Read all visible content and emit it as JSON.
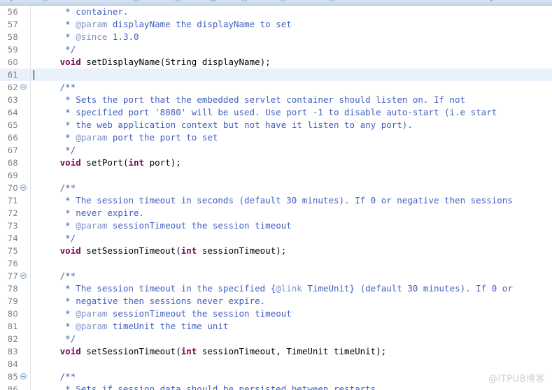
{
  "toolbar": {
    "glyphs": [
      "▾",
      "▭",
      "↶",
      "↷",
      "▭",
      "▭",
      "⌘",
      "▭",
      "▭",
      "▭",
      "▾"
    ]
  },
  "editor": {
    "first_visible_line": 56,
    "active_line": 61,
    "cursor_column": 1,
    "colors": {
      "javadoc": "#3f5fbf",
      "javadoc_tag": "#7a93c9",
      "keyword": "#7f0055",
      "plain": "#000000",
      "active_line_bg": "#e9f1fd",
      "line_number": "#7d7d7d",
      "background": "#ffffff"
    },
    "lines": [
      {
        "num": "56",
        "fold": false,
        "active": false,
        "tokens": [
          {
            "t": "doc",
            "s": "      * container."
          }
        ]
      },
      {
        "num": "57",
        "fold": false,
        "active": false,
        "tokens": [
          {
            "t": "doc",
            "s": "      * "
          },
          {
            "t": "tag",
            "s": "@param"
          },
          {
            "t": "doc",
            "s": " displayName the displayName to set"
          }
        ]
      },
      {
        "num": "58",
        "fold": false,
        "active": false,
        "tokens": [
          {
            "t": "doc",
            "s": "      * "
          },
          {
            "t": "tag",
            "s": "@since"
          },
          {
            "t": "doc",
            "s": " 1.3.0"
          }
        ]
      },
      {
        "num": "59",
        "fold": false,
        "active": false,
        "tokens": [
          {
            "t": "doc",
            "s": "      */"
          }
        ]
      },
      {
        "num": "60",
        "fold": false,
        "active": false,
        "tokens": [
          {
            "t": "plain",
            "s": "     "
          },
          {
            "t": "kw",
            "s": "void"
          },
          {
            "t": "plain",
            "s": " setDisplayName(String displayName);"
          }
        ]
      },
      {
        "num": "61",
        "fold": false,
        "active": true,
        "tokens": [
          {
            "t": "plain",
            "s": ""
          }
        ]
      },
      {
        "num": "62",
        "fold": true,
        "active": false,
        "tokens": [
          {
            "t": "doc",
            "s": "     /**"
          }
        ]
      },
      {
        "num": "63",
        "fold": false,
        "active": false,
        "tokens": [
          {
            "t": "doc",
            "s": "      * Sets the port that the embedded servlet container should listen on. If not"
          }
        ]
      },
      {
        "num": "64",
        "fold": false,
        "active": false,
        "tokens": [
          {
            "t": "doc",
            "s": "      * specified port '8080' will be used. Use port -1 to disable auto-start (i.e start"
          }
        ]
      },
      {
        "num": "65",
        "fold": false,
        "active": false,
        "tokens": [
          {
            "t": "doc",
            "s": "      * the web application context but not have it listen to any port)."
          }
        ]
      },
      {
        "num": "66",
        "fold": false,
        "active": false,
        "tokens": [
          {
            "t": "doc",
            "s": "      * "
          },
          {
            "t": "tag",
            "s": "@param"
          },
          {
            "t": "doc",
            "s": " port the port to set"
          }
        ]
      },
      {
        "num": "67",
        "fold": false,
        "active": false,
        "tokens": [
          {
            "t": "doc",
            "s": "      */"
          }
        ]
      },
      {
        "num": "68",
        "fold": false,
        "active": false,
        "tokens": [
          {
            "t": "plain",
            "s": "     "
          },
          {
            "t": "kw",
            "s": "void"
          },
          {
            "t": "plain",
            "s": " setPort("
          },
          {
            "t": "kw",
            "s": "int"
          },
          {
            "t": "plain",
            "s": " port);"
          }
        ]
      },
      {
        "num": "69",
        "fold": false,
        "active": false,
        "tokens": [
          {
            "t": "plain",
            "s": ""
          }
        ]
      },
      {
        "num": "70",
        "fold": true,
        "active": false,
        "tokens": [
          {
            "t": "doc",
            "s": "     /**"
          }
        ]
      },
      {
        "num": "71",
        "fold": false,
        "active": false,
        "tokens": [
          {
            "t": "doc",
            "s": "      * The session timeout in seconds (default 30 minutes). If 0 or negative then sessions"
          }
        ]
      },
      {
        "num": "72",
        "fold": false,
        "active": false,
        "tokens": [
          {
            "t": "doc",
            "s": "      * never expire."
          }
        ]
      },
      {
        "num": "73",
        "fold": false,
        "active": false,
        "tokens": [
          {
            "t": "doc",
            "s": "      * "
          },
          {
            "t": "tag",
            "s": "@param"
          },
          {
            "t": "doc",
            "s": " sessionTimeout the session timeout"
          }
        ]
      },
      {
        "num": "74",
        "fold": false,
        "active": false,
        "tokens": [
          {
            "t": "doc",
            "s": "      */"
          }
        ]
      },
      {
        "num": "75",
        "fold": false,
        "active": false,
        "tokens": [
          {
            "t": "plain",
            "s": "     "
          },
          {
            "t": "kw",
            "s": "void"
          },
          {
            "t": "plain",
            "s": " setSessionTimeout("
          },
          {
            "t": "kw",
            "s": "int"
          },
          {
            "t": "plain",
            "s": " sessionTimeout);"
          }
        ]
      },
      {
        "num": "76",
        "fold": false,
        "active": false,
        "tokens": [
          {
            "t": "plain",
            "s": ""
          }
        ]
      },
      {
        "num": "77",
        "fold": true,
        "active": false,
        "tokens": [
          {
            "t": "doc",
            "s": "     /**"
          }
        ]
      },
      {
        "num": "78",
        "fold": false,
        "active": false,
        "tokens": [
          {
            "t": "doc",
            "s": "      * The session timeout in the specified {"
          },
          {
            "t": "tag",
            "s": "@link"
          },
          {
            "t": "doc",
            "s": " TimeUnit} (default 30 minutes). If 0 or"
          }
        ]
      },
      {
        "num": "79",
        "fold": false,
        "active": false,
        "tokens": [
          {
            "t": "doc",
            "s": "      * negative then sessions never expire."
          }
        ]
      },
      {
        "num": "80",
        "fold": false,
        "active": false,
        "tokens": [
          {
            "t": "doc",
            "s": "      * "
          },
          {
            "t": "tag",
            "s": "@param"
          },
          {
            "t": "doc",
            "s": " sessionTimeout the session timeout"
          }
        ]
      },
      {
        "num": "81",
        "fold": false,
        "active": false,
        "tokens": [
          {
            "t": "doc",
            "s": "      * "
          },
          {
            "t": "tag",
            "s": "@param"
          },
          {
            "t": "doc",
            "s": " timeUnit the time unit"
          }
        ]
      },
      {
        "num": "82",
        "fold": false,
        "active": false,
        "tokens": [
          {
            "t": "doc",
            "s": "      */"
          }
        ]
      },
      {
        "num": "83",
        "fold": false,
        "active": false,
        "tokens": [
          {
            "t": "plain",
            "s": "     "
          },
          {
            "t": "kw",
            "s": "void"
          },
          {
            "t": "plain",
            "s": " setSessionTimeout("
          },
          {
            "t": "kw",
            "s": "int"
          },
          {
            "t": "plain",
            "s": " sessionTimeout, TimeUnit timeUnit);"
          }
        ]
      },
      {
        "num": "84",
        "fold": false,
        "active": false,
        "tokens": [
          {
            "t": "plain",
            "s": ""
          }
        ]
      },
      {
        "num": "85",
        "fold": true,
        "active": false,
        "tokens": [
          {
            "t": "doc",
            "s": "     /**"
          }
        ]
      },
      {
        "num": "86",
        "fold": false,
        "active": false,
        "tokens": [
          {
            "t": "doc",
            "s": "      * Sets if session data should be persisted between restarts"
          }
        ]
      }
    ]
  },
  "watermark": {
    "text": "@ITPUB博客"
  }
}
